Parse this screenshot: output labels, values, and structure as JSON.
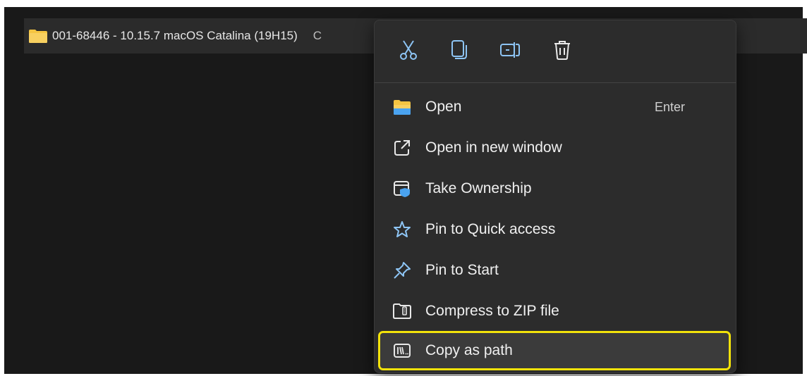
{
  "file": {
    "name": "001-68446 - 10.15.7 macOS Catalina (19H15)",
    "extra": "C"
  },
  "quick_actions": [
    {
      "icon": "cut-icon"
    },
    {
      "icon": "copy-icon"
    },
    {
      "icon": "rename-icon"
    },
    {
      "icon": "delete-icon"
    }
  ],
  "menu": {
    "items": [
      {
        "label": "Open",
        "shortcut": "Enter",
        "icon": "folder-icon"
      },
      {
        "label": "Open in new window",
        "icon": "open-new-window-icon"
      },
      {
        "label": "Take Ownership",
        "icon": "take-ownership-icon"
      },
      {
        "label": "Pin to Quick access",
        "icon": "star-icon"
      },
      {
        "label": "Pin to Start",
        "icon": "pin-icon"
      },
      {
        "label": "Compress to ZIP file",
        "icon": "zip-icon"
      },
      {
        "label": "Copy as path",
        "icon": "copy-path-icon"
      }
    ]
  },
  "colors": {
    "highlight_outline": "#f2e20a",
    "accent_blue": "#4aa3f0",
    "folder_yellow": "#f5c542"
  }
}
